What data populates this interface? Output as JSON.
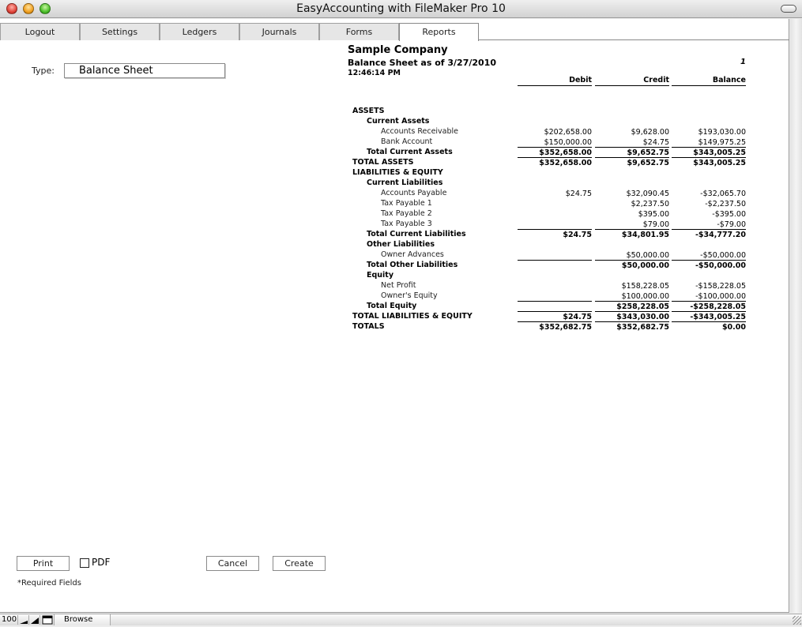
{
  "window": {
    "title": "EasyAccounting with FileMaker Pro 10"
  },
  "tabs": [
    {
      "label": "Logout",
      "active": false
    },
    {
      "label": "Settings",
      "active": false
    },
    {
      "label": "Ledgers",
      "active": false
    },
    {
      "label": "Journals",
      "active": false
    },
    {
      "label": "Forms",
      "active": false
    },
    {
      "label": "Reports",
      "active": true
    }
  ],
  "form": {
    "type_label": "Type:",
    "type_value": "Balance Sheet"
  },
  "report": {
    "company": "Sample Company",
    "subtitle": "Balance Sheet as of 3/27/2010",
    "time": "12:46:14 PM",
    "page": "1",
    "columns": [
      "Debit",
      "Credit",
      "Balance"
    ],
    "rows": [
      {
        "label": "ASSETS",
        "level": 0,
        "bold": true,
        "debit": "",
        "credit": "",
        "balance": ""
      },
      {
        "label": "Current Assets",
        "level": 1,
        "bold": true,
        "debit": "",
        "credit": "",
        "balance": ""
      },
      {
        "label": "Accounts Receivable",
        "level": 2,
        "bold": false,
        "debit": "$202,658.00",
        "credit": "$9,628.00",
        "balance": "$193,030.00"
      },
      {
        "label": "Bank Account",
        "level": 2,
        "bold": false,
        "debit": "$150,000.00",
        "credit": "$24.75",
        "balance": "$149,975.25",
        "underline": true
      },
      {
        "label": "Total Current Assets",
        "level": 1,
        "bold": true,
        "debit": "$352,658.00",
        "credit": "$9,652.75",
        "balance": "$343,005.25",
        "underline": true
      },
      {
        "label": "TOTAL ASSETS",
        "level": 0,
        "bold": true,
        "debit": "$352,658.00",
        "credit": "$9,652.75",
        "balance": "$343,005.25"
      },
      {
        "label": "LIABILITIES & EQUITY",
        "level": 0,
        "bold": true,
        "debit": "",
        "credit": "",
        "balance": ""
      },
      {
        "label": "Current Liabilities",
        "level": 1,
        "bold": true,
        "debit": "",
        "credit": "",
        "balance": ""
      },
      {
        "label": "Accounts Payable",
        "level": 2,
        "bold": false,
        "debit": "$24.75",
        "credit": "$32,090.45",
        "balance": "-$32,065.70"
      },
      {
        "label": "Tax Payable 1",
        "level": 2,
        "bold": false,
        "debit": "",
        "credit": "$2,237.50",
        "balance": "-$2,237.50"
      },
      {
        "label": "Tax Payable 2",
        "level": 2,
        "bold": false,
        "debit": "",
        "credit": "$395.00",
        "balance": "-$395.00"
      },
      {
        "label": "Tax Payable 3",
        "level": 2,
        "bold": false,
        "debit": "",
        "credit": "$79.00",
        "balance": "-$79.00",
        "underline": true
      },
      {
        "label": "Total Current Liabilities",
        "level": 1,
        "bold": true,
        "debit": "$24.75",
        "credit": "$34,801.95",
        "balance": "-$34,777.20"
      },
      {
        "label": "Other Liabilities",
        "level": 1,
        "bold": true,
        "debit": "",
        "credit": "",
        "balance": ""
      },
      {
        "label": "Owner Advances",
        "level": 2,
        "bold": false,
        "debit": "",
        "credit": "$50,000.00",
        "balance": "-$50,000.00",
        "underline": true
      },
      {
        "label": "Total Other Liabilities",
        "level": 1,
        "bold": true,
        "debit": "",
        "credit": "$50,000.00",
        "balance": "-$50,000.00"
      },
      {
        "label": "Equity",
        "level": 1,
        "bold": true,
        "debit": "",
        "credit": "",
        "balance": ""
      },
      {
        "label": "Net Profit",
        "level": 2,
        "bold": false,
        "debit": "",
        "credit": "$158,228.05",
        "balance": "-$158,228.05"
      },
      {
        "label": "Owner's Equity",
        "level": 2,
        "bold": false,
        "debit": "",
        "credit": "$100,000.00",
        "balance": "-$100,000.00",
        "underline": true
      },
      {
        "label": "Total Equity",
        "level": 1,
        "bold": true,
        "debit": "",
        "credit": "$258,228.05",
        "balance": "-$258,228.05",
        "underline": true
      },
      {
        "label": "TOTAL LIABILITIES & EQUITY",
        "level": 0,
        "bold": true,
        "debit": "$24.75",
        "credit": "$343,030.00",
        "balance": "-$343,005.25",
        "underline": true
      },
      {
        "label": "TOTALS",
        "level": 0,
        "bold": true,
        "debit": "$352,682.75",
        "credit": "$352,682.75",
        "balance": "$0.00"
      }
    ]
  },
  "buttons": {
    "print": "Print",
    "pdf": "PDF",
    "cancel": "Cancel",
    "create": "Create"
  },
  "pdf_checked": false,
  "required_note": "*Required Fields",
  "statusbar": {
    "zoom": "100",
    "mode": "Browse"
  }
}
